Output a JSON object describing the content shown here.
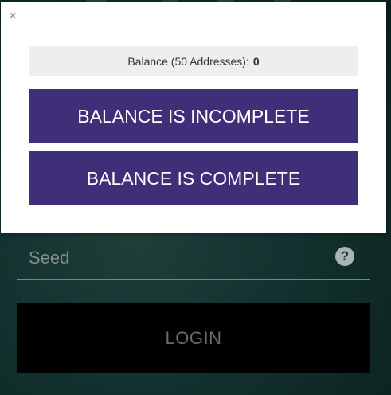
{
  "modal": {
    "close_symbol": "×",
    "balance_label": "Balance (50 Addresses):",
    "balance_value": "0",
    "incomplete_button": "BALANCE IS INCOMPLETE",
    "complete_button": "BALANCE IS COMPLETE"
  },
  "login_form": {
    "seed_placeholder": "Seed",
    "help_symbol": "?",
    "login_button": "LOGIN"
  },
  "icons": {
    "close": "close-icon",
    "help": "question-circle-icon"
  },
  "colors": {
    "accent_purple": "#3f2f78",
    "background_teal": "#153431",
    "login_button_bg": "#000000",
    "balance_bar_bg": "#eeeeee"
  }
}
